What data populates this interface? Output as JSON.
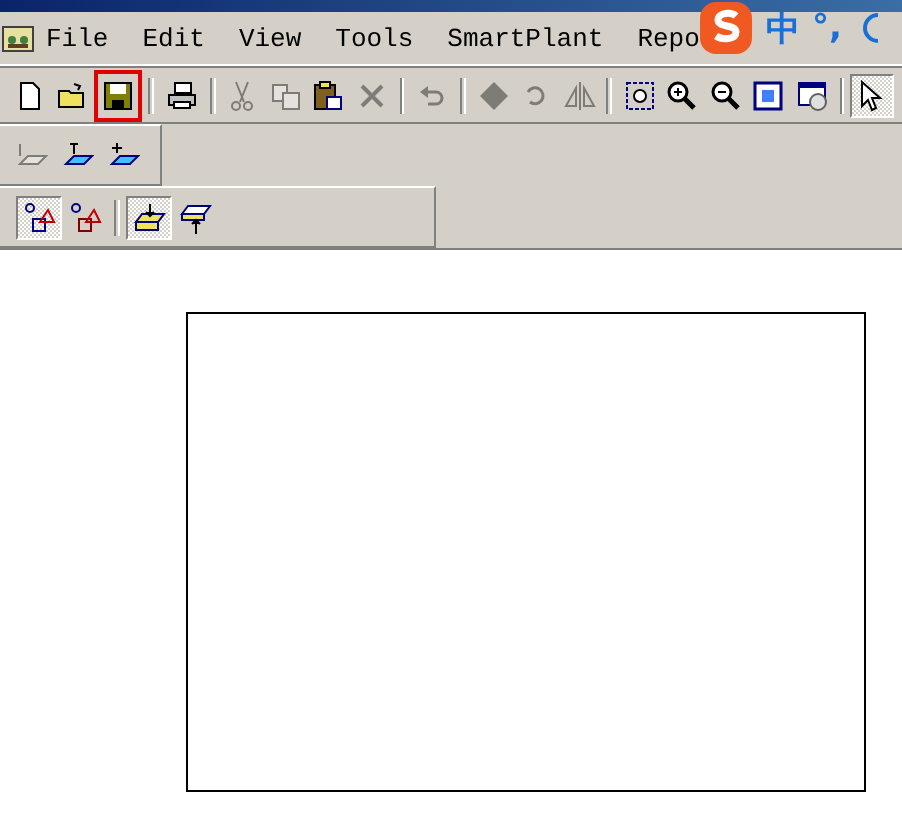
{
  "menu_bar": {
    "items": [
      "File",
      "Edit",
      "View",
      "Tools",
      "SmartPlant",
      "Repo"
    ]
  },
  "ime_bar": {
    "items": [
      "中",
      "°,"
    ]
  },
  "toolbars": [
    {
      "groups": [
        [
          {
            "disabled": false,
            "pressed": false,
            "highlighted": false
          },
          {
            "disabled": false,
            "pressed": false,
            "highlighted": false
          },
          {
            "disabled": false,
            "pressed": false,
            "highlighted": true
          }
        ],
        [
          {
            "disabled": false,
            "pressed": false,
            "highlighted": false
          }
        ],
        [
          {
            "disabled": true,
            "pressed": false,
            "highlighted": false
          },
          {
            "disabled": true,
            "pressed": false,
            "highlighted": false
          },
          {
            "disabled": false,
            "pressed": false,
            "highlighted": false
          },
          {
            "disabled": true,
            "pressed": false,
            "highlighted": false
          }
        ],
        [
          {
            "disabled": true,
            "pressed": false,
            "highlighted": false
          }
        ],
        [
          {
            "disabled": true,
            "pressed": false,
            "highlighted": false
          },
          {
            "disabled": true,
            "pressed": false,
            "highlighted": false
          },
          {
            "disabled": true,
            "pressed": false,
            "highlighted": false
          }
        ],
        [
          {
            "disabled": false,
            "pressed": false,
            "highlighted": false
          },
          {
            "disabled": false,
            "pressed": false,
            "highlighted": false
          },
          {
            "disabled": false,
            "pressed": false,
            "highlighted": false
          },
          {
            "disabled": false,
            "pressed": false,
            "highlighted": false
          },
          {
            "disabled": false,
            "pressed": false,
            "highlighted": false
          }
        ],
        [
          {
            "disabled": false,
            "pressed": true,
            "highlighted": false
          }
        ]
      ]
    },
    {
      "groups": [
        [
          {
            "disabled": true,
            "pressed": false,
            "highlighted": false
          },
          {
            "disabled": false,
            "pressed": false,
            "highlighted": false
          },
          {
            "disabled": false,
            "pressed": false,
            "highlighted": false
          }
        ]
      ]
    },
    {
      "groups": [
        [
          {
            "disabled": false,
            "pressed": true,
            "highlighted": false
          },
          {
            "disabled": false,
            "pressed": false,
            "highlighted": false
          }
        ],
        [
          {
            "disabled": false,
            "pressed": true,
            "highlighted": false
          },
          {
            "disabled": false,
            "pressed": false,
            "highlighted": false
          }
        ]
      ]
    }
  ]
}
